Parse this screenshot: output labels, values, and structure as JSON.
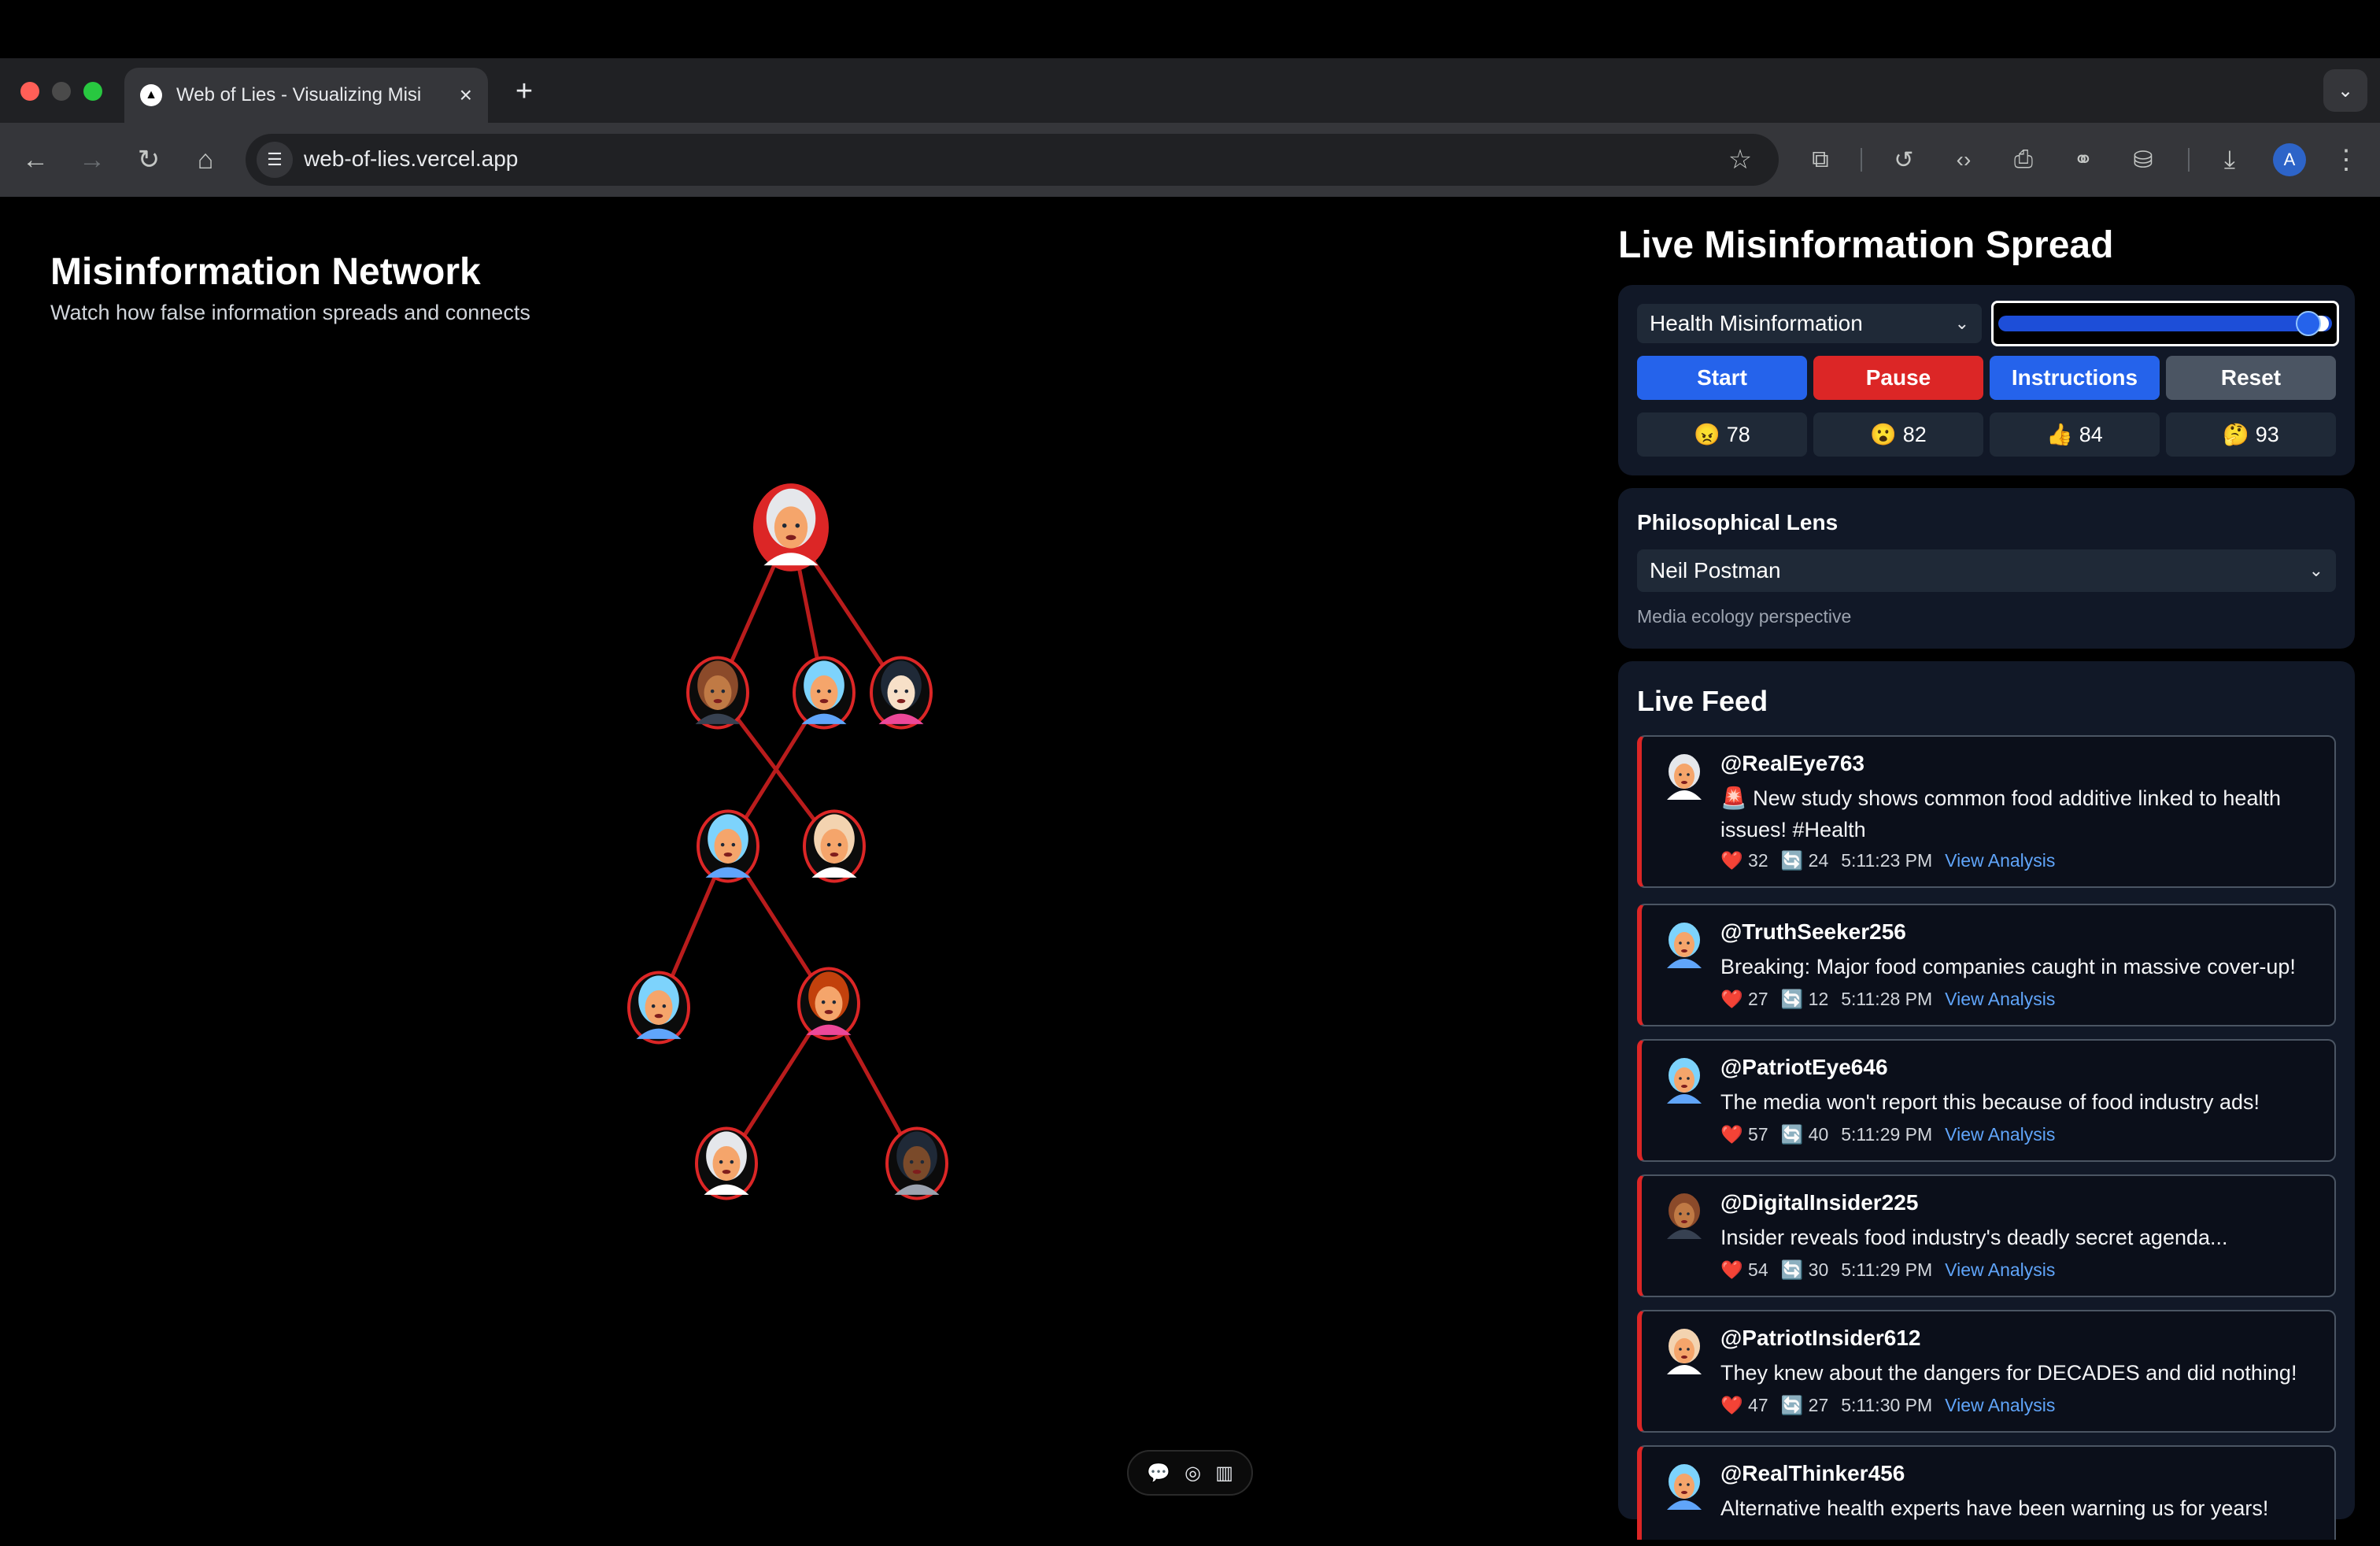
{
  "browser": {
    "tab_title": "Web of Lies - Visualizing Misi",
    "url": "web-of-lies.vercel.app",
    "profile_initial": "A"
  },
  "network": {
    "title": "Misinformation Network",
    "subtitle": "Watch how false information spreads and connects",
    "edge_color": "#b91c1c",
    "node_border_color": "#dc2626"
  },
  "spread": {
    "title": "Live Misinformation Spread",
    "topic_selected": "Health Misinformation",
    "speed_level": 0.95,
    "buttons": {
      "start": "Start",
      "pause": "Pause",
      "instructions": "Instructions",
      "reset": "Reset"
    },
    "stats": [
      {
        "icon": "😠",
        "value": "78"
      },
      {
        "icon": "😮",
        "value": "82"
      },
      {
        "icon": "👍",
        "value": "84"
      },
      {
        "icon": "🤔",
        "value": "93"
      }
    ]
  },
  "lens": {
    "title": "Philosophical Lens",
    "selected": "Neil Postman",
    "description": "Media ecology perspective"
  },
  "feed": {
    "title": "Live Feed",
    "posts": [
      {
        "user": "@RealEye763",
        "text": "🚨 New study shows common food additive linked to health issues! #Health",
        "likes": "32",
        "shares": "24",
        "time": "5:11:23 PM",
        "link": "View Analysis"
      },
      {
        "user": "@TruthSeeker256",
        "text": "Breaking: Major food companies caught in massive cover-up!",
        "likes": "27",
        "shares": "12",
        "time": "5:11:28 PM",
        "link": "View Analysis"
      },
      {
        "user": "@PatriotEye646",
        "text": "The media won't report this because of food industry ads!",
        "likes": "57",
        "shares": "40",
        "time": "5:11:29 PM",
        "link": "View Analysis"
      },
      {
        "user": "@DigitalInsider225",
        "text": "Insider reveals food industry's deadly secret agenda...",
        "likes": "54",
        "shares": "30",
        "time": "5:11:29 PM",
        "link": "View Analysis"
      },
      {
        "user": "@PatriotInsider612",
        "text": "They knew about the dangers for DECADES and did nothing!",
        "likes": "47",
        "shares": "27",
        "time": "5:11:30 PM",
        "link": "View Analysis"
      },
      {
        "user": "@RealThinker456",
        "text": "Alternative health experts have been warning us for years!",
        "likes": "",
        "shares": "",
        "time": "",
        "link": ""
      }
    ],
    "like_icon": "❤️",
    "share_icon": "🔄"
  }
}
